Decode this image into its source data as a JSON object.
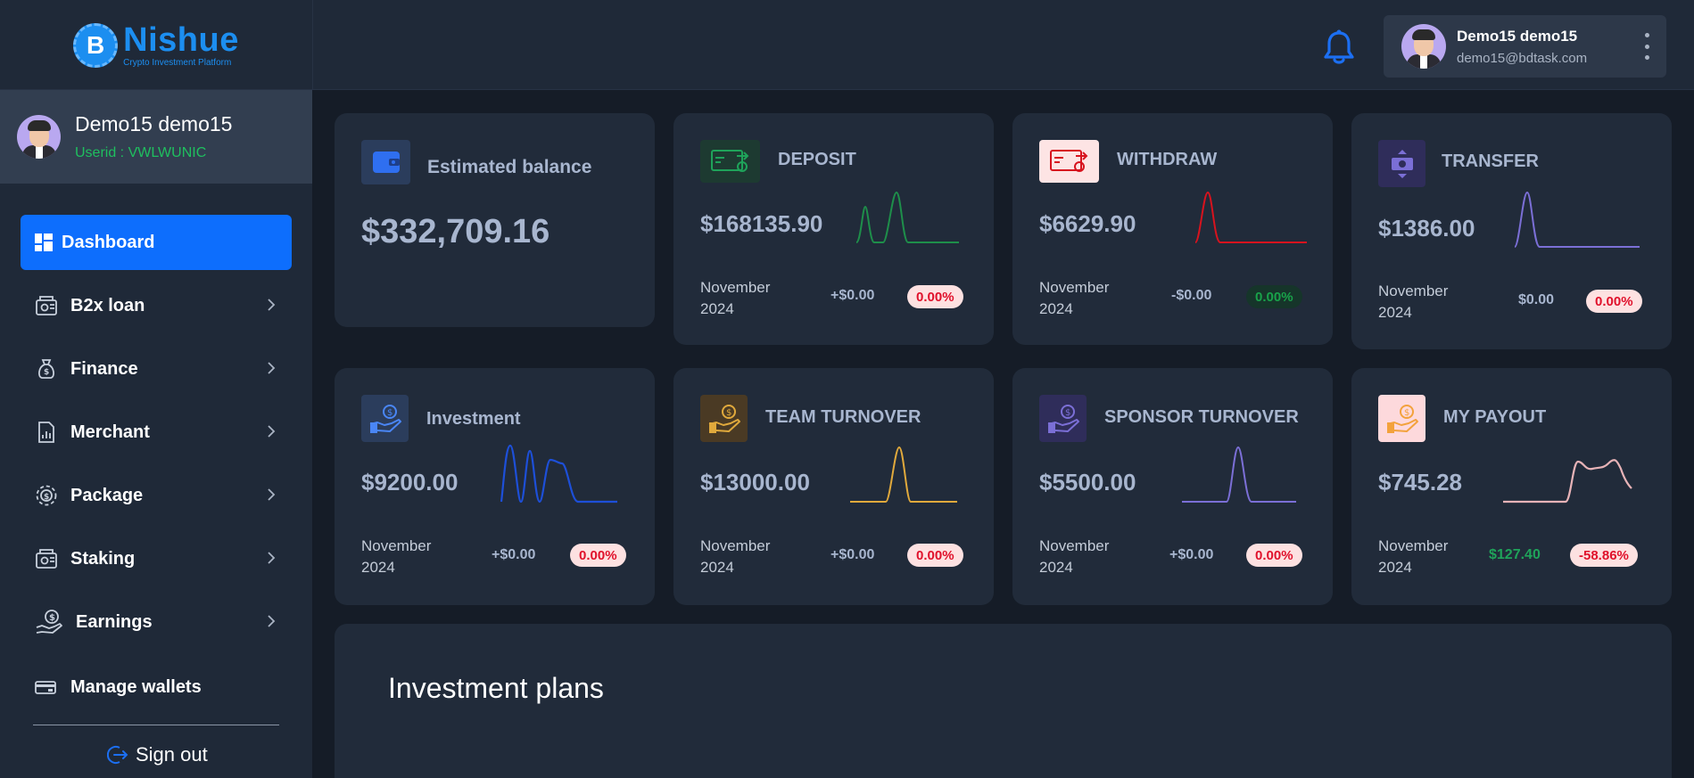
{
  "brand": {
    "name": "Nishue",
    "tagline": "Crypto Investment Platform",
    "coin_letter": "B"
  },
  "header": {
    "user_name": "Demo15 demo15",
    "user_email": "demo15@bdtask.com"
  },
  "sidebar": {
    "user_name": "Demo15 demo15",
    "user_id": "Userid : VWLWUNIC",
    "items": [
      {
        "label": "Dashboard",
        "icon": "dashboard-icon",
        "active": true,
        "has_submenu": false
      },
      {
        "label": "B2x loan",
        "icon": "loan-icon",
        "active": false,
        "has_submenu": true
      },
      {
        "label": "Finance",
        "icon": "money-bag-icon",
        "active": false,
        "has_submenu": true
      },
      {
        "label": "Merchant",
        "icon": "merchant-icon",
        "active": false,
        "has_submenu": true
      },
      {
        "label": "Package",
        "icon": "package-icon",
        "active": false,
        "has_submenu": true
      },
      {
        "label": "Staking",
        "icon": "staking-icon",
        "active": false,
        "has_submenu": true
      },
      {
        "label": "Earnings",
        "icon": "earnings-icon",
        "active": false,
        "has_submenu": true
      },
      {
        "label": "Manage wallets",
        "icon": "wallet-card-icon",
        "active": false,
        "has_submenu": false
      }
    ],
    "signout": "Sign out"
  },
  "balance": {
    "title": "Estimated balance",
    "value": "$332,709.16"
  },
  "cards": {
    "deposit": {
      "title": "DEPOSIT",
      "value": "$168135.90",
      "month": "November",
      "year": "2024",
      "delta": "+$0.00",
      "percent": "0.00%",
      "color": "#1e8e4a"
    },
    "withdraw": {
      "title": "WITHDRAW",
      "value": "$6629.90",
      "month": "November",
      "year": "2024",
      "delta": "-$0.00",
      "percent": "0.00%",
      "color": "#d7131e"
    },
    "transfer": {
      "title": "TRANSFER",
      "value": "$1386.00",
      "month": "November",
      "year": "2024",
      "delta": "$0.00",
      "percent": "0.00%",
      "color": "#7b6fd6"
    },
    "investment": {
      "title": "Investment",
      "value": "$9200.00",
      "month": "November",
      "year": "2024",
      "delta": "+$0.00",
      "percent": "0.00%",
      "color": "#1d4fd8"
    },
    "team_turnover": {
      "title": "TEAM TURNOVER",
      "value": "$13000.00",
      "month": "November",
      "year": "2024",
      "delta": "+$0.00",
      "percent": "0.00%",
      "color": "#e0a93c"
    },
    "sponsor_turnover": {
      "title": "SPONSOR TURNOVER",
      "value": "$5500.00",
      "month": "November",
      "year": "2024",
      "delta": "+$0.00",
      "percent": "0.00%",
      "color": "#7b6fd6"
    },
    "my_payout": {
      "title": "MY PAYOUT",
      "value": "$745.28",
      "month": "November",
      "year": "2024",
      "delta": "$127.40",
      "percent": "-58.86%",
      "color": "#e7b3b7"
    }
  },
  "plans": {
    "title": "Investment plans"
  }
}
